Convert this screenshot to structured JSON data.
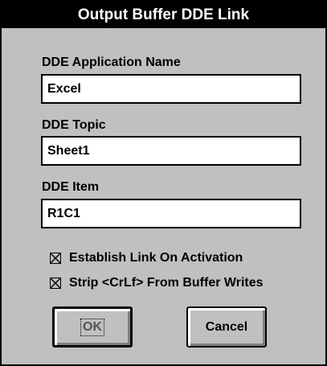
{
  "dialog": {
    "title": "Output Buffer DDE Link"
  },
  "fields": {
    "app_name": {
      "label": "DDE Application Name",
      "value": "Excel"
    },
    "topic": {
      "label": "DDE Topic",
      "value": "Sheet1"
    },
    "item": {
      "label": "DDE Item",
      "value": "R1C1"
    }
  },
  "options": {
    "establish_link": {
      "label": "Establish Link On Activation",
      "checked": true
    },
    "strip_crlf": {
      "label": "Strip <CrLf> From Buffer Writes",
      "checked": true
    }
  },
  "buttons": {
    "ok_label": "OK",
    "cancel_label": "Cancel"
  },
  "colors": {
    "face": "#c0c0c0",
    "title_bar": "#000000",
    "title_text": "#ffffff",
    "field_background": "#ffffff"
  },
  "icons": {
    "checkbox_mark": "x-check-icon"
  }
}
